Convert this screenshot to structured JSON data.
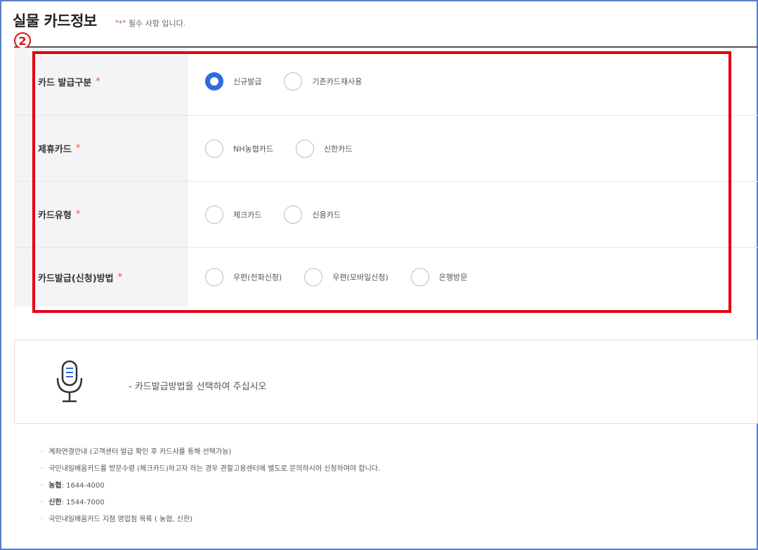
{
  "header": {
    "title": "실물 카드정보",
    "required_note_prefix": "\"",
    "required_note_star": "*",
    "required_note_suffix": "\" 필수 사항 입니다.",
    "step_number": "2"
  },
  "form": {
    "required_mark": "*",
    "rows": [
      {
        "label": "카드 발급구분",
        "options": [
          {
            "label": "신규발급",
            "checked": true
          },
          {
            "label": "기존카드재사용",
            "checked": false
          }
        ]
      },
      {
        "label": "제휴카드",
        "options": [
          {
            "label": "NH농협카드",
            "checked": false
          },
          {
            "label": "신한카드",
            "checked": false
          }
        ]
      },
      {
        "label": "카드유형",
        "options": [
          {
            "label": "체크카드",
            "checked": false
          },
          {
            "label": "신용카드",
            "checked": false
          }
        ]
      },
      {
        "label": "카드발급(신청)방법",
        "options": [
          {
            "label": "우편(전화신청)",
            "checked": false
          },
          {
            "label": "우편(모바일신청)",
            "checked": false
          },
          {
            "label": "은행방문",
            "checked": false
          }
        ]
      }
    ]
  },
  "notice": {
    "icon": "microphone-icon",
    "text": "- 카드발급방법을 선택하여 주십시오"
  },
  "info": {
    "line1": "계좌연결안내 (고객센터 발급 확인 후 카드사를 통해 선택가능)",
    "line2": "국민내일배움카드를 방문수령 (체크카드)하고자 하는 경우 관할고용센터에 별도로 문의하시어 신청하여야 합니다.",
    "nh_label": "농협",
    "nh_phone": ": 1644-4000",
    "sh_label": "신한",
    "sh_phone": ": 1544-7000",
    "line5": "국민내일배움카드 지점 영업점 목록 ( 농협, 신한)"
  },
  "colors": {
    "accent": "#2f6be0",
    "required": "#e8582a",
    "highlight": "#e10010",
    "frame": "#5b7fc7"
  }
}
